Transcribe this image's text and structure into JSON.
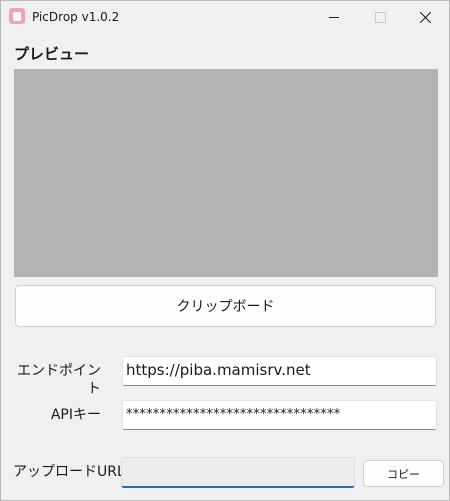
{
  "window": {
    "title": "PicDrop v1.0.2",
    "icon": "picdrop-app-icon",
    "controls": {
      "minimize_icon": "minimize-icon",
      "maximize_icon": "maximize-icon",
      "close_icon": "close-icon"
    }
  },
  "preview": {
    "heading": "プレビュー",
    "placeholder_color": "#b3b3b3"
  },
  "clipboard_button": {
    "label": "クリップボード"
  },
  "settings": {
    "endpoint_label": "エンドポイント",
    "endpoint_value": "https://piba.mamisrv.net",
    "apikey_label": "APIキー",
    "apikey_value": "********************************"
  },
  "upload": {
    "label": "アップロードURL",
    "url_value": "",
    "copy_label": "コピー"
  },
  "colors": {
    "focus_underline": "#2f6aa7",
    "app_icon": "#f2a3b3"
  }
}
